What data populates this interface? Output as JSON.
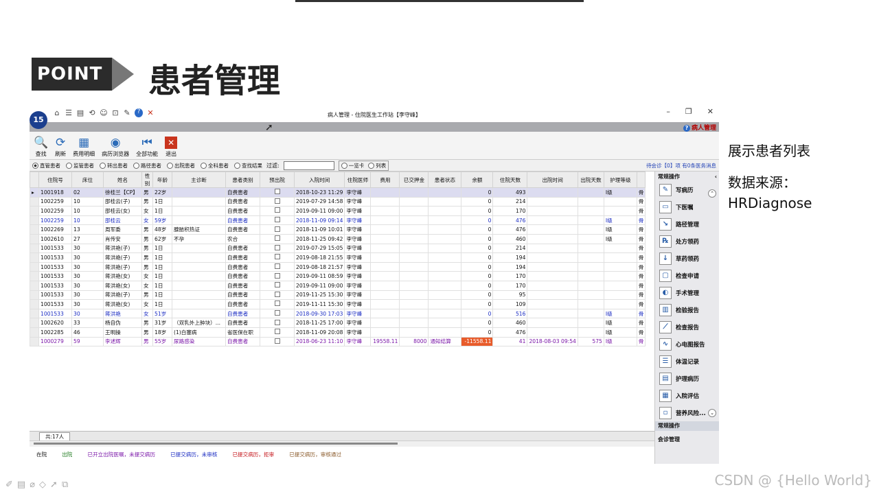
{
  "slide": {
    "point_label": "POINT",
    "title": "患者管理",
    "notes": [
      "展示患者列表",
      "数据来源：",
      "HRDiagnose"
    ],
    "watermark": "CSDN @ {Hello World}"
  },
  "window": {
    "logo": "15",
    "title": "病人管理 - 住院医生工作站【李守峰】",
    "module": "病人管理",
    "qa_icons": [
      "home-icon",
      "list-icon",
      "report-icon",
      "refresh-icon",
      "user-icon",
      "lock-icon",
      "tag-icon",
      "help-icon",
      "close-icon"
    ],
    "controls": [
      "–",
      "❐",
      "✕"
    ]
  },
  "toolbar": [
    {
      "label": "查找",
      "icon": "search-icon",
      "glyph": "🔍"
    },
    {
      "label": "刷新",
      "icon": "refresh-icon",
      "glyph": "⟳"
    },
    {
      "label": "费用明细",
      "icon": "cost-icon",
      "glyph": "▦"
    },
    {
      "label": "病历浏览器",
      "icon": "browser-icon",
      "glyph": "◉"
    },
    {
      "label": "全部功能",
      "icon": "functions-icon",
      "glyph": "⏮"
    },
    {
      "label": "退出",
      "icon": "exit-icon",
      "glyph": "✕"
    }
  ],
  "filters": {
    "radios": [
      {
        "label": "直管患者",
        "checked": true
      },
      {
        "label": "监管患者",
        "checked": false
      },
      {
        "label": "转出患者",
        "checked": false
      },
      {
        "label": "路径患者",
        "checked": false
      },
      {
        "label": "出院患者",
        "checked": false
      },
      {
        "label": "全科患者",
        "checked": false
      },
      {
        "label": "查找结果",
        "checked": false
      }
    ],
    "filter_label": "过滤:",
    "view_options": [
      {
        "label": "一览卡",
        "checked": false
      },
      {
        "label": "列表",
        "checked": false
      }
    ],
    "wait_text": "待会诊【0】项 有0条医务消息"
  },
  "table": {
    "columns": [
      "住院号",
      "床位",
      "姓名",
      "性别",
      "年龄",
      "主诊断",
      "患者类别",
      "预出院",
      "入院时间",
      "住院医师",
      "费用",
      "已交押金",
      "患者状态",
      "余额",
      "住院天数",
      "出院时间",
      "出院天数",
      "护理等级",
      ""
    ],
    "rows": [
      {
        "style": "sel",
        "cells": [
          "1001918",
          "02",
          "徐桂兰【CP】",
          "男",
          "22岁",
          "",
          "自费患者",
          "☐",
          "2018-10-23 11:29",
          "李守峰",
          "",
          "",
          "",
          "0",
          "493",
          "",
          "",
          "I级",
          "骨"
        ]
      },
      {
        "style": "",
        "cells": [
          "1002259",
          "10",
          "邵桂云(子)",
          "男",
          "1日",
          "",
          "自费患者",
          "☐",
          "2019-07-29 14:58",
          "李守峰",
          "",
          "",
          "",
          "0",
          "214",
          "",
          "",
          "",
          "骨"
        ]
      },
      {
        "style": "",
        "cells": [
          "1002259",
          "10",
          "邵桂云(女)",
          "女",
          "1日",
          "",
          "自费患者",
          "☐",
          "2019-09-11 09:00",
          "李守峰",
          "",
          "",
          "",
          "0",
          "170",
          "",
          "",
          "",
          "骨"
        ]
      },
      {
        "style": "blue",
        "cells": [
          "1002259",
          "10",
          "邵桂云",
          "女",
          "59岁",
          "",
          "自费患者",
          "☐",
          "2018-11-09 09:14",
          "李守峰",
          "",
          "",
          "",
          "0",
          "476",
          "",
          "",
          "I级",
          "骨"
        ]
      },
      {
        "style": "",
        "cells": [
          "1002269",
          "13",
          "周军委",
          "男",
          "48岁",
          "腺脓积热证",
          "自费患者",
          "☐",
          "2018-11-09 10:01",
          "李守峰",
          "",
          "",
          "",
          "0",
          "476",
          "",
          "",
          "I级",
          "骨"
        ]
      },
      {
        "style": "",
        "cells": [
          "1002610",
          "27",
          "肖传安",
          "男",
          "62岁",
          "不孕",
          "农合",
          "☐",
          "2018-11-25 09:42",
          "李守峰",
          "",
          "",
          "",
          "0",
          "460",
          "",
          "",
          "I级",
          "骨"
        ]
      },
      {
        "style": "",
        "cells": [
          "1001533",
          "30",
          "蒋洪艳(子)",
          "男",
          "1日",
          "",
          "自费患者",
          "☐",
          "2019-07-29 15:05",
          "李守峰",
          "",
          "",
          "",
          "0",
          "214",
          "",
          "",
          "",
          "骨"
        ]
      },
      {
        "style": "",
        "cells": [
          "1001533",
          "30",
          "蒋洪艳(子)",
          "男",
          "1日",
          "",
          "自费患者",
          "☐",
          "2019-08-18 21:55",
          "李守峰",
          "",
          "",
          "",
          "0",
          "194",
          "",
          "",
          "",
          "骨"
        ]
      },
      {
        "style": "",
        "cells": [
          "1001533",
          "30",
          "蒋洪艳(子)",
          "男",
          "1日",
          "",
          "自费患者",
          "☐",
          "2019-08-18 21:57",
          "李守峰",
          "",
          "",
          "",
          "0",
          "194",
          "",
          "",
          "",
          "骨"
        ]
      },
      {
        "style": "",
        "cells": [
          "1001533",
          "30",
          "蒋洪艳(女)",
          "女",
          "1日",
          "",
          "自费患者",
          "☐",
          "2019-09-11 08:59",
          "李守峰",
          "",
          "",
          "",
          "0",
          "170",
          "",
          "",
          "",
          "骨"
        ]
      },
      {
        "style": "",
        "cells": [
          "1001533",
          "30",
          "蒋洪艳(女)",
          "女",
          "1日",
          "",
          "自费患者",
          "☐",
          "2019-09-11 09:00",
          "李守峰",
          "",
          "",
          "",
          "0",
          "170",
          "",
          "",
          "",
          "骨"
        ]
      },
      {
        "style": "",
        "cells": [
          "1001533",
          "30",
          "蒋洪艳(子)",
          "男",
          "1日",
          "",
          "自费患者",
          "☐",
          "2019-11-25 15:30",
          "李守峰",
          "",
          "",
          "",
          "0",
          "95",
          "",
          "",
          "",
          "骨"
        ]
      },
      {
        "style": "",
        "cells": [
          "1001533",
          "30",
          "蒋洪艳(女)",
          "女",
          "1日",
          "",
          "自费患者",
          "☐",
          "2019-11-11 15:30",
          "李守峰",
          "",
          "",
          "",
          "0",
          "109",
          "",
          "",
          "",
          "骨"
        ]
      },
      {
        "style": "blue",
        "cells": [
          "1001533",
          "30",
          "蒋洪艳",
          "女",
          "51岁",
          "",
          "自费患者",
          "☐",
          "2018-09-30 17:03",
          "李守峰",
          "",
          "",
          "",
          "0",
          "516",
          "",
          "",
          "I级",
          "骨"
        ]
      },
      {
        "style": "",
        "cells": [
          "1002620",
          "33",
          "杨自伪",
          "男",
          "31岁",
          "（双乳外上肿块）...",
          "自费患者",
          "☐",
          "2018-11-25 17:00",
          "李守峰",
          "",
          "",
          "",
          "0",
          "460",
          "",
          "",
          "I级",
          "骨"
        ]
      },
      {
        "style": "",
        "cells": [
          "1002285",
          "46",
          "王明操",
          "男",
          "18岁",
          "(1)白塞病",
          "省医保在职",
          "☐",
          "2018-11-09 20:08",
          "李守峰",
          "",
          "",
          "",
          "0",
          "476",
          "",
          "",
          "I级",
          "骨"
        ]
      },
      {
        "style": "purple",
        "cells": [
          "1000279",
          "59",
          "李述辉",
          "男",
          "55岁",
          "尿路感染",
          "自费患者",
          "☐",
          "2018-06-23 11:10",
          "李守峰",
          "19558.11",
          "8000",
          "通知结算",
          "-11558.11",
          "41",
          "2018-08-03 09:54",
          "575",
          "I级",
          "骨"
        ]
      }
    ]
  },
  "footer": {
    "count": "共:17人",
    "legend": [
      {
        "label": "在院",
        "color": "#111111"
      },
      {
        "label": "出院",
        "color": "#1d7a1d"
      },
      {
        "label": "已开立出院医嘱，未提交病历",
        "color": "#7a16a8"
      },
      {
        "label": "已提交病历，未审核",
        "color": "#1a2bc2"
      },
      {
        "label": "已提交病历，拒审",
        "color": "#c4141a"
      },
      {
        "label": "已提交病历，审核通过",
        "color": "#8a5a2a"
      }
    ]
  },
  "sidebar": {
    "header": "常规操作",
    "items": [
      {
        "label": "写病历",
        "icon": "write-record-icon",
        "glyph": "✎"
      },
      {
        "label": "下医嘱",
        "icon": "order-icon",
        "glyph": "▭"
      },
      {
        "label": "路径管理",
        "icon": "path-icon",
        "glyph": "↘"
      },
      {
        "label": "处方领药",
        "icon": "prescription-icon",
        "glyph": "℞"
      },
      {
        "label": "草药领药",
        "icon": "herb-icon",
        "glyph": "↓"
      },
      {
        "label": "检查申请",
        "icon": "exam-request-icon",
        "glyph": "▢"
      },
      {
        "label": "手术管理",
        "icon": "surgery-icon",
        "glyph": "◐"
      },
      {
        "label": "检验报告",
        "icon": "lab-report-icon",
        "glyph": "▥"
      },
      {
        "label": "检查报告",
        "icon": "exam-report-icon",
        "glyph": "⟋"
      },
      {
        "label": "心电图报告",
        "icon": "ecg-icon",
        "glyph": "∿"
      },
      {
        "label": "体温记录",
        "icon": "temperature-icon",
        "glyph": "☰"
      },
      {
        "label": "护理病历",
        "icon": "nursing-icon",
        "glyph": "▤"
      },
      {
        "label": "入院评估",
        "icon": "assessment-icon",
        "glyph": "▦"
      },
      {
        "label": "营养风险...",
        "icon": "nutrition-icon",
        "glyph": "▫"
      }
    ],
    "bottom1": "常规操作",
    "bottom2": "会诊管理"
  }
}
